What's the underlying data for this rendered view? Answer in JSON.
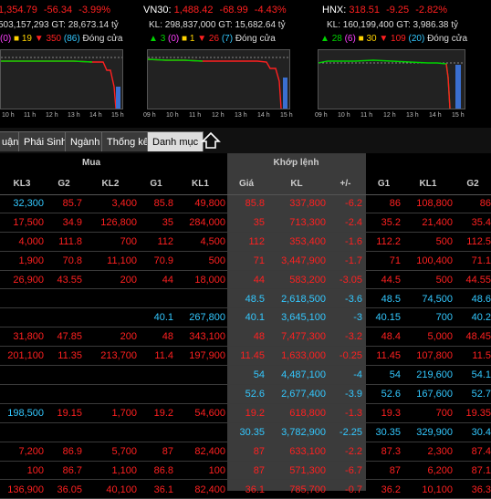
{
  "colors": {
    "up": "#00d200",
    "down": "#ff2020",
    "ref": "#ffd400",
    "ceil": "#ff40ff",
    "floor": "#33c8ff",
    "neutral": "#ddd"
  },
  "indices": [
    {
      "name": "",
      "value": "1,354.79",
      "change": "-56.34",
      "pct": "-3.99%",
      "kl": "503,157,293",
      "gt": "GT: 28,673.14 tỷ",
      "up": "",
      "up_ceil": "(0)",
      "ref": "19",
      "down": "350",
      "floor": "(86)",
      "status": "Đóng cửa",
      "trend": "down",
      "ticks": [
        "10 h",
        "11 h",
        "12 h",
        "13 h",
        "14 h",
        "15 h"
      ]
    },
    {
      "name": "VN30:",
      "value": "1,488.42",
      "change": "-68.99",
      "pct": "-4.43%",
      "kl": "KL: 298,837,000",
      "gt": "GT: 15,682.64 tỷ",
      "up": "3",
      "up_ceil": "(0)",
      "ref": "1",
      "down": "26",
      "floor": "(7)",
      "status": "Đóng cửa",
      "trend": "down",
      "ticks": [
        "09 h",
        "10 h",
        "11 h",
        "12 h",
        "13 h",
        "14 h",
        "15 h"
      ]
    },
    {
      "name": "HNX:",
      "value": "318.51",
      "change": "-9.25",
      "pct": "-2.82%",
      "kl": "KL: 160,199,400",
      "gt": "GT: 3,986.38 tỷ",
      "up": "28",
      "up_ceil": "(6)",
      "ref": "30",
      "down": "109",
      "floor": "(20)",
      "status": "Đóng cửa",
      "trend": "down",
      "ticks": [
        "09 h",
        "10 h",
        "11 h",
        "12 h",
        "13 h",
        "14 h",
        "15 h"
      ]
    }
  ],
  "tabs": [
    "uận",
    "Phái Sinh",
    "Ngành",
    "Thống kê",
    "Danh mục"
  ],
  "table": {
    "group_buy": "Mua",
    "group_match": "Khớp lệnh",
    "headers": [
      "KL3",
      "G2",
      "KL2",
      "G1",
      "KL1",
      "Giá",
      "KL",
      "+/-",
      "G1",
      "KL1",
      "G2"
    ],
    "rows": [
      [
        "32,300",
        "85.7",
        "3,400",
        "85.8",
        "49,800",
        "85.8",
        "337,800",
        "-6.2",
        "86",
        "108,800",
        "86"
      ],
      [
        "17,500",
        "34.9",
        "126,800",
        "35",
        "284,000",
        "35",
        "713,300",
        "-2.4",
        "35.2",
        "21,400",
        "35.4"
      ],
      [
        "4,000",
        "111.8",
        "700",
        "112",
        "4,500",
        "112",
        "353,400",
        "-1.6",
        "112.2",
        "500",
        "112.5"
      ],
      [
        "1,900",
        "70.8",
        "11,100",
        "70.9",
        "500",
        "71",
        "3,447,900",
        "-1.7",
        "71",
        "100,400",
        "71.1"
      ],
      [
        "26,900",
        "43.55",
        "200",
        "44",
        "18,000",
        "44",
        "583,200",
        "-3.05",
        "44.5",
        "500",
        "44.55"
      ],
      [
        "",
        "",
        "",
        "",
        "",
        "48.5",
        "2,618,500",
        "-3.6",
        "48.5",
        "74,500",
        "48.6"
      ],
      [
        "",
        "",
        "",
        "40.1",
        "267,800",
        "40.1",
        "3,645,100",
        "-3",
        "40.15",
        "700",
        "40.2"
      ],
      [
        "31,800",
        "47.85",
        "200",
        "48",
        "343,100",
        "48",
        "7,477,300",
        "-3.2",
        "48.4",
        "5,000",
        "48.45"
      ],
      [
        "201,100",
        "11.35",
        "213,700",
        "11.4",
        "197,900",
        "11.45",
        "1,633,000",
        "-0.25",
        "11.45",
        "107,800",
        "11.5"
      ],
      [
        "",
        "",
        "",
        "",
        "",
        "54",
        "4,487,100",
        "-4",
        "54",
        "219,600",
        "54.1"
      ],
      [
        "",
        "",
        "",
        "",
        "",
        "52.6",
        "2,677,400",
        "-3.9",
        "52.6",
        "167,600",
        "52.7"
      ],
      [
        "198,500",
        "19.15",
        "1,700",
        "19.2",
        "54,600",
        "19.2",
        "618,800",
        "-1.3",
        "19.3",
        "700",
        "19.35"
      ],
      [
        "",
        "",
        "",
        "",
        "",
        "30.35",
        "3,782,900",
        "-2.25",
        "30.35",
        "329,900",
        "30.4"
      ],
      [
        "7,200",
        "86.9",
        "5,700",
        "87",
        "82,400",
        "87",
        "633,100",
        "-2.2",
        "87.3",
        "2,300",
        "87.4"
      ],
      [
        "100",
        "86.7",
        "1,100",
        "86.8",
        "100",
        "87",
        "571,300",
        "-6.7",
        "87",
        "6,200",
        "87.1"
      ],
      [
        "136,900",
        "36.05",
        "40,100",
        "36.1",
        "82,400",
        "36.1",
        "785,700",
        "-0.7",
        "36.2",
        "10,100",
        "36.3"
      ]
    ],
    "row_colors": [
      "down",
      "down",
      "down",
      "down",
      "down",
      "floor",
      "floor",
      "down",
      "down",
      "floor",
      "floor",
      "down",
      "floor",
      "down",
      "down",
      "down"
    ]
  }
}
